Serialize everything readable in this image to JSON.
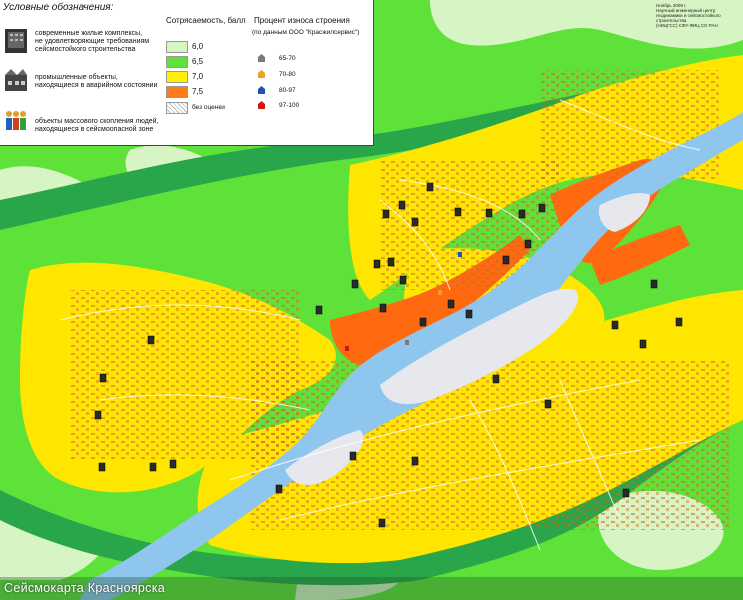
{
  "legend": {
    "title": "Условные обозначения:",
    "objects": [
      {
        "icon": "residential-building-icon",
        "label": "современные жилые комплексы,\nне удовлетворяющие требованиям\nсейсмостойкого строительства"
      },
      {
        "icon": "industrial-building-icon",
        "label": "промышленные объекты,\nнаходящиеся в аварийном состоянии"
      },
      {
        "icon": "crowd-icon",
        "label": "объекты массового скопления людей,\nнаходящиеся в сейсмоопасной зоне"
      }
    ],
    "seismicity": {
      "title": "Сотрясаемость, балл",
      "levels": [
        {
          "label": "6,0",
          "color": "#d7f5c4"
        },
        {
          "label": "6,5",
          "color": "#5ee23a"
        },
        {
          "label": "7,0",
          "color": "#ffef00"
        },
        {
          "label": "7,5",
          "color": "#ff7a1a"
        },
        {
          "label": "без оценки",
          "color": "hatched"
        }
      ]
    },
    "wear": {
      "title": "Процент износа строения",
      "source": "(по данным ООО \"Красжилсервис\")",
      "levels": [
        {
          "label": "65-70",
          "color": "#7a7a7a"
        },
        {
          "label": "70-80",
          "color": "#f0a020"
        },
        {
          "label": "80-97",
          "color": "#2050c0"
        },
        {
          "label": "97-100",
          "color": "#d01818"
        }
      ]
    }
  },
  "center_note": "Ноябрь 2009 г.\nНаучный инженерный центр\nгеодинамики и сейсмостойкого строительства\n(НИЦГСС) СФУ-ФИЦ СО РАН",
  "footer_title": "Сейсмокарта Красноярска",
  "colors": {
    "river": "#8ec6ee",
    "sandbar": "#e6e8ee",
    "zone_6_5": "#2aa64a",
    "zone_7_0": "#ffe600",
    "zone_7_5": "#ff6a10",
    "urban_fill": "#f4d23c",
    "building": "#b04a1c"
  }
}
